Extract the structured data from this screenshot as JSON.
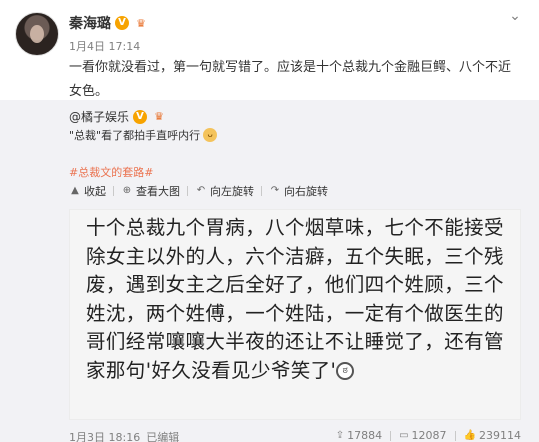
{
  "post": {
    "author": "秦海璐",
    "badge": "V",
    "crown": "♛",
    "timestamp": "1月4日 17:14",
    "text": "一看你就没看过，第一句就写错了。应该是十个总裁九个金融巨鳄、八个不近女色。",
    "menu_icon": "chevron-down-icon"
  },
  "repost": {
    "author": "@橘子娱乐",
    "text": "\"总裁\"看了都拍手直呼内行",
    "topic": "#总裁文的套路#",
    "toolbar": {
      "collect": "收起",
      "view_large": "查看大图",
      "rotate_left": "向左旋转",
      "rotate_right": "向右旋转"
    },
    "image_text": "十个总裁九个胃病，八个烟草味，七个不能接受除女主以外的人，六个洁癖，五个失眠，三个残废，遇到女主之后全好了，他们四个姓顾，三个姓沈，两个姓傅，一个姓陆，一定有个做医生的哥们经常嚷嚷大半夜的还让不让睡觉了，还有管家那句'好久没看见少爷笑了'",
    "timestamp": "1月3日 18:16",
    "edited": "已编辑",
    "stats": {
      "reposts": "17884",
      "comments": "12087",
      "likes": "239114"
    }
  }
}
